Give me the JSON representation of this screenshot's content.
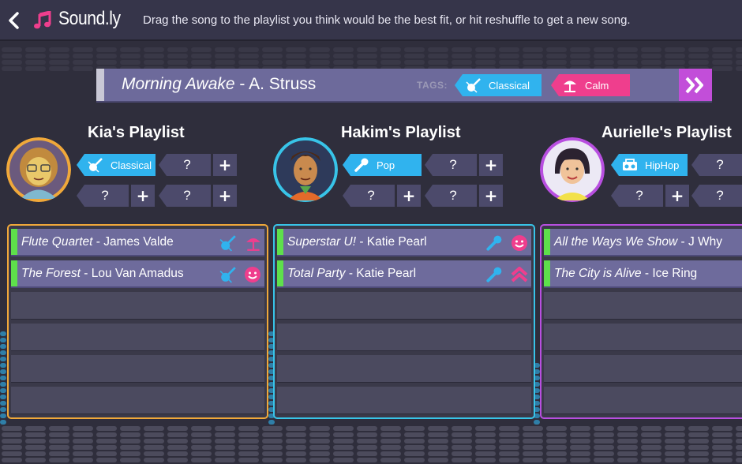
{
  "app": {
    "name": "Sound.ly",
    "instruction": "Drag the song to the playlist you think would be the best fit, or hit reshuffle to get a new song."
  },
  "colors": {
    "blue": "#30b3ee",
    "pink": "#ef3e8d",
    "green": "#5ee04b",
    "purple": "#c24ed9",
    "orange": "#f0a83a",
    "cyan": "#38c4e8",
    "violet": "#b84fe0"
  },
  "song": {
    "title": "Morning Awake",
    "artist": " - A. Struss",
    "tags_label": "TAGS:",
    "tags": [
      {
        "label": "Classical",
        "icon": "violin-icon"
      },
      {
        "label": "Calm",
        "icon": "beach-umbrella-icon"
      }
    ]
  },
  "playlists": [
    {
      "name": "Kia's Playlist",
      "tags": [
        "Classical",
        "?",
        "?",
        "?"
      ],
      "songs": [
        {
          "title": "Flute Quartet",
          "artist": " - James Valde",
          "icons": [
            "violin-icon",
            "beach-umbrella-icon"
          ]
        },
        {
          "title": "The Forest",
          "artist": " - Lou Van Amadus",
          "icons": [
            "violin-icon",
            "smiley-icon"
          ]
        }
      ]
    },
    {
      "name": "Hakim's Playlist",
      "tags": [
        "Pop",
        "?",
        "?",
        "?"
      ],
      "songs": [
        {
          "title": "Superstar U!",
          "artist": " - Katie Pearl",
          "icons": [
            "microphone-icon",
            "smiley-icon"
          ]
        },
        {
          "title": "Total Party",
          "artist": " - Katie Pearl",
          "icons": [
            "microphone-icon",
            "double-chevron-up-icon"
          ]
        }
      ]
    },
    {
      "name": "Aurielle's Playlist",
      "tags": [
        "HipHop",
        "?",
        "?",
        "?"
      ],
      "songs": [
        {
          "title": "All the Ways We Show",
          "artist": " - J Why",
          "icons": []
        },
        {
          "title": "The City is Alive",
          "artist": " - Ice Ring",
          "icons": []
        }
      ]
    }
  ]
}
